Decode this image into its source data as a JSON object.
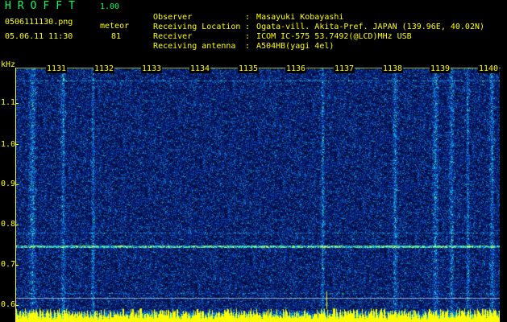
{
  "header": {
    "title": "HROFFT",
    "version": "1.00",
    "filename": "0506111130.png",
    "mode": "meteor",
    "datetime": "05.06.11 11:30",
    "count": "81"
  },
  "info": [
    {
      "key": "Observer",
      "sep": ":",
      "value": "Masayuki Kobayashi"
    },
    {
      "key": "Receiving Location",
      "sep": ":",
      "value": "Ogata-vill. Akita-Pref. JAPAN (139.96E, 40.02N)"
    },
    {
      "key": "Receiver",
      "sep": ":",
      "value": "ICOM IC-575 53.7492(@LCD)MHz USB"
    },
    {
      "key": "Receiving antenna",
      "sep": ":",
      "value": "A504HB(yagi 4el)"
    }
  ],
  "axis": {
    "unit": "kHz",
    "y_labels": [
      "1.1",
      "1.0",
      "0.9",
      "0.8",
      "0.7",
      "0.6"
    ],
    "x_labels": [
      "1131",
      "1132",
      "1133",
      "1134",
      "1135",
      "1136",
      "1137",
      "1138",
      "1139",
      "1140"
    ]
  },
  "colors": {
    "text": "#ffff00",
    "title": "#00ff66",
    "background": "#000000",
    "spectrum_base": "#030830"
  }
}
